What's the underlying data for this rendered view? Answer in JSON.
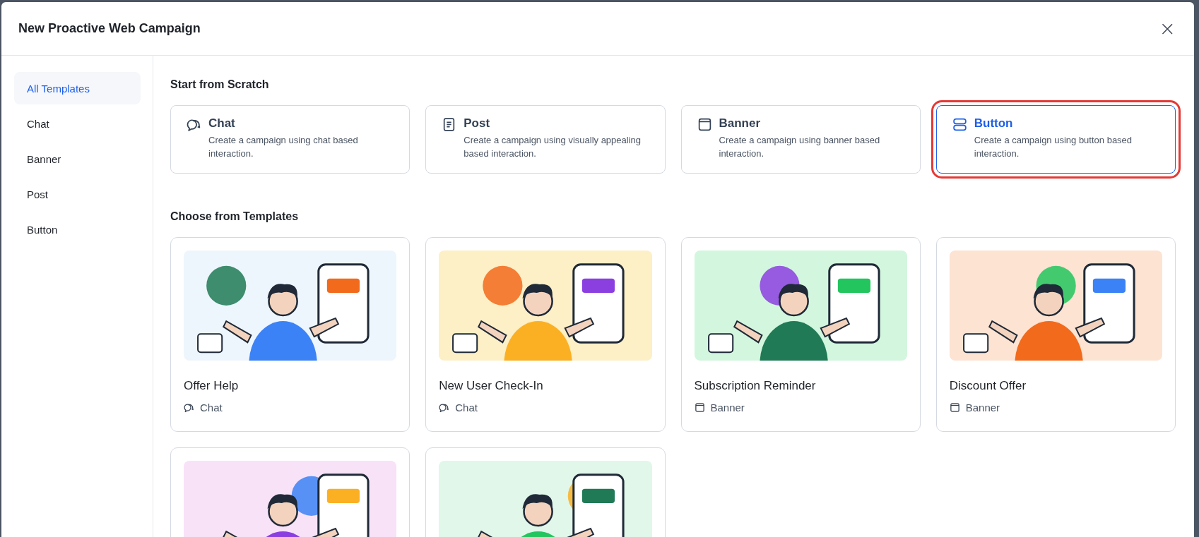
{
  "window": {
    "title": "New Proactive Web Campaign",
    "close": "×"
  },
  "sidebar": {
    "items": [
      {
        "label": "All Templates",
        "selected": true
      },
      {
        "label": "Chat",
        "selected": false
      },
      {
        "label": "Banner",
        "selected": false
      },
      {
        "label": "Post",
        "selected": false
      },
      {
        "label": "Button",
        "selected": false
      }
    ]
  },
  "scratch": {
    "heading": "Start from Scratch",
    "cards": [
      {
        "kind": "chat",
        "title": "Chat",
        "description": "Create a campaign using chat based interaction.",
        "selected": false
      },
      {
        "kind": "post",
        "title": "Post",
        "description": "Create a campaign using visually appealing based interaction.",
        "selected": false
      },
      {
        "kind": "banner",
        "title": "Banner",
        "description": "Create a campaign using banner based interaction.",
        "selected": false
      },
      {
        "kind": "button",
        "title": "Button",
        "description": "Create a campaign using button based interaction.",
        "selected": true
      }
    ]
  },
  "templates": {
    "heading": "Choose from Templates",
    "cards": [
      {
        "kind": "picture",
        "color": "#eef6fd",
        "title": "Offer Help",
        "tag": {
          "kind": "chat",
          "label": "Chat"
        }
      },
      {
        "kind": "picture",
        "color": "#fdefc6",
        "title": "New User Check-In",
        "tag": {
          "kind": "chat",
          "label": "Chat"
        }
      },
      {
        "kind": "picture",
        "color": "#d3f6de",
        "title": "Subscription Reminder",
        "tag": {
          "kind": "banner",
          "label": "Banner"
        }
      },
      {
        "kind": "picture",
        "color": "#fde3d2",
        "title": "Discount Offer",
        "tag": {
          "kind": "banner",
          "label": "Banner"
        }
      },
      {
        "kind": "picture",
        "color": "#f8e2f8"
      },
      {
        "kind": "picture",
        "color": "#e1f7ea"
      }
    ]
  }
}
